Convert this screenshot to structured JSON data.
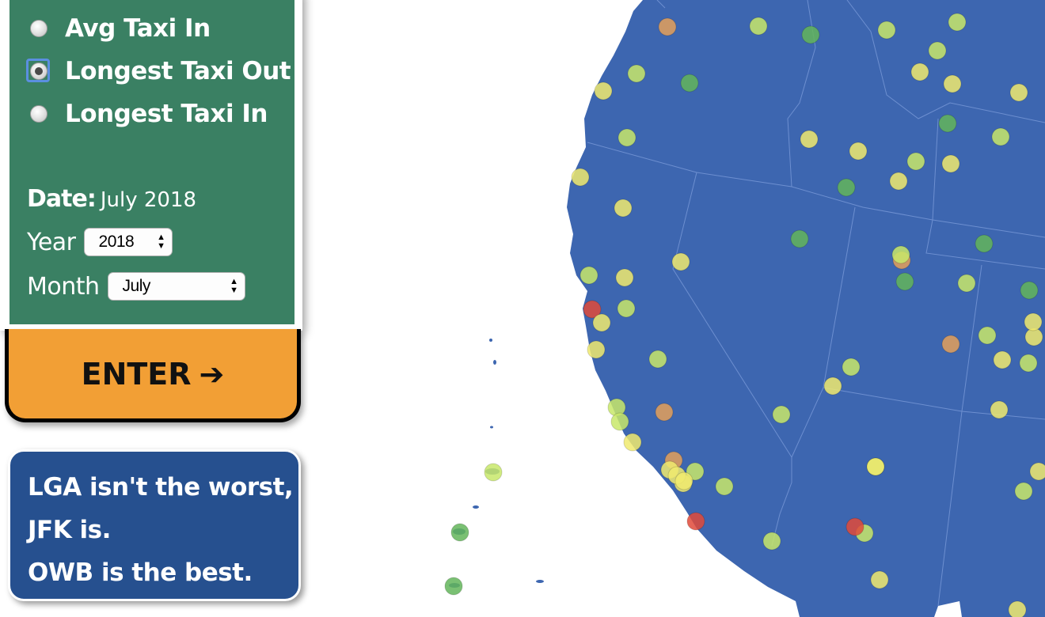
{
  "controls": {
    "radio_options": [
      {
        "label": "Avg Taxi In",
        "selected": false
      },
      {
        "label": "Longest Taxi Out",
        "selected": true
      },
      {
        "label": "Longest Taxi In",
        "selected": false
      }
    ],
    "date_label": "Date:",
    "date_value": "July 2018",
    "year_label": "Year",
    "year_value": "2018",
    "month_label": "Month",
    "month_value": "July"
  },
  "enter_button": {
    "label": "ENTER",
    "icon": "arrow-right-icon"
  },
  "message": {
    "lines": [
      "LGA isn't the worst,",
      "JFK is.",
      "OWB is the best."
    ]
  },
  "colors": {
    "land": "#3d66b0",
    "panel": "#3a8063",
    "button": "#f29f35",
    "message_box": "#26508f",
    "airport_scale": {
      "best": "#8ee05a",
      "good": "#c8e86a",
      "medium": "#f0ea6e",
      "poor": "#e4a05a",
      "worst": "#e04a3a",
      "dark_green": "#63b55a"
    }
  },
  "airports": [
    {
      "level": "poor"
    },
    {
      "level": "good"
    },
    {
      "level": "dark_green"
    },
    {
      "level": "good"
    },
    {
      "level": "good"
    },
    {
      "level": "medium"
    },
    {
      "level": "good"
    },
    {
      "level": "dark_green"
    },
    {
      "level": "medium"
    },
    {
      "level": "medium"
    },
    {
      "level": "good"
    },
    {
      "level": "medium"
    },
    {
      "level": "dark_green"
    },
    {
      "level": "good"
    },
    {
      "level": "medium"
    },
    {
      "level": "medium"
    },
    {
      "level": "good"
    },
    {
      "level": "medium"
    },
    {
      "level": "dark_green"
    },
    {
      "level": "medium"
    },
    {
      "level": "good"
    },
    {
      "level": "medium"
    },
    {
      "level": "medium"
    },
    {
      "level": "dark_green"
    },
    {
      "level": "medium"
    },
    {
      "level": "poor"
    },
    {
      "level": "dark_green"
    },
    {
      "level": "good"
    },
    {
      "level": "good"
    },
    {
      "level": "dark_green"
    },
    {
      "level": "medium"
    },
    {
      "level": "good"
    },
    {
      "level": "worst"
    },
    {
      "level": "medium"
    },
    {
      "level": "medium"
    },
    {
      "level": "good"
    },
    {
      "level": "good"
    },
    {
      "level": "medium"
    },
    {
      "level": "good"
    },
    {
      "level": "medium"
    },
    {
      "level": "poor"
    },
    {
      "level": "good"
    },
    {
      "level": "medium"
    },
    {
      "level": "good"
    },
    {
      "level": "good"
    },
    {
      "level": "medium"
    },
    {
      "level": "medium"
    },
    {
      "level": "dark_green"
    },
    {
      "level": "medium"
    },
    {
      "level": "poor"
    },
    {
      "level": "good"
    },
    {
      "level": "poor"
    },
    {
      "level": "good"
    },
    {
      "level": "medium"
    },
    {
      "level": "medium"
    },
    {
      "level": "good"
    },
    {
      "level": "good"
    },
    {
      "level": "good"
    },
    {
      "level": "worst"
    },
    {
      "level": "good"
    },
    {
      "level": "medium"
    },
    {
      "level": "worst"
    },
    {
      "level": "good"
    },
    {
      "level": "medium"
    },
    {
      "level": "medium"
    },
    {
      "level": "good"
    },
    {
      "level": "medium"
    },
    {
      "level": "good"
    },
    {
      "level": "dark_green"
    },
    {
      "level": "dark_green"
    },
    {
      "level": "medium"
    },
    {
      "level": "medium"
    }
  ]
}
